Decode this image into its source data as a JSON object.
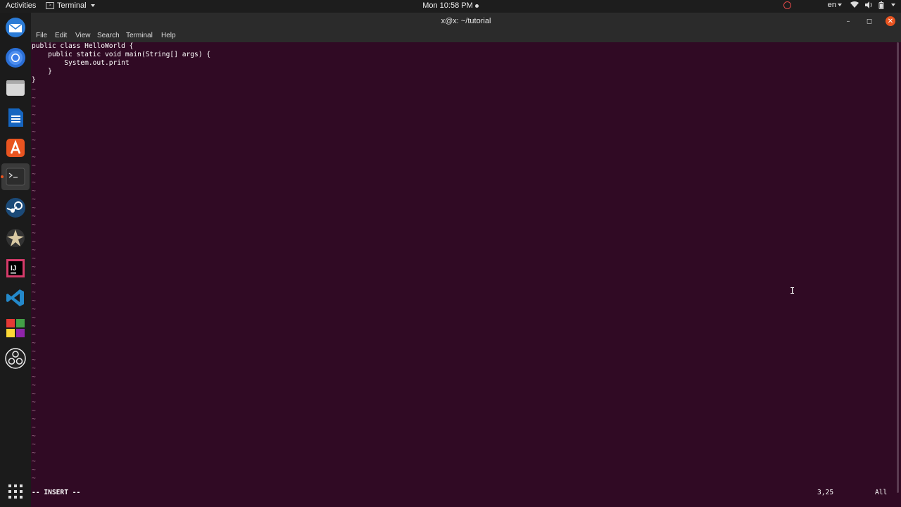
{
  "topbar": {
    "activities": "Activities",
    "app_name": "Terminal",
    "clock": "Mon 10:58 PM",
    "language": "en"
  },
  "dock": {
    "items": [
      {
        "name": "thunderbird-icon"
      },
      {
        "name": "chrome-icon"
      },
      {
        "name": "files-icon"
      },
      {
        "name": "writer-icon"
      },
      {
        "name": "software-icon"
      },
      {
        "name": "terminal-icon",
        "active": true
      },
      {
        "name": "steam-icon"
      },
      {
        "name": "inkscape-icon"
      },
      {
        "name": "intellij-icon"
      },
      {
        "name": "vscode-icon"
      },
      {
        "name": "puzzle-icon"
      },
      {
        "name": "obs-icon"
      }
    ],
    "apps_grid": "show-applications-icon"
  },
  "window": {
    "title": "x@x: ~/tutorial",
    "menu": [
      "File",
      "Edit",
      "View",
      "Search",
      "Terminal",
      "Help"
    ]
  },
  "editor": {
    "lines": [
      "public class HelloWorld {",
      "    public static void main(String[] args) {",
      "        System.out.print",
      "    }",
      "}"
    ],
    "tilde_char": "~",
    "mode": "-- INSERT --",
    "position": "3,25",
    "scroll": "All"
  },
  "colors": {
    "terminal_bg": "#300a24",
    "accent": "#e95420"
  }
}
